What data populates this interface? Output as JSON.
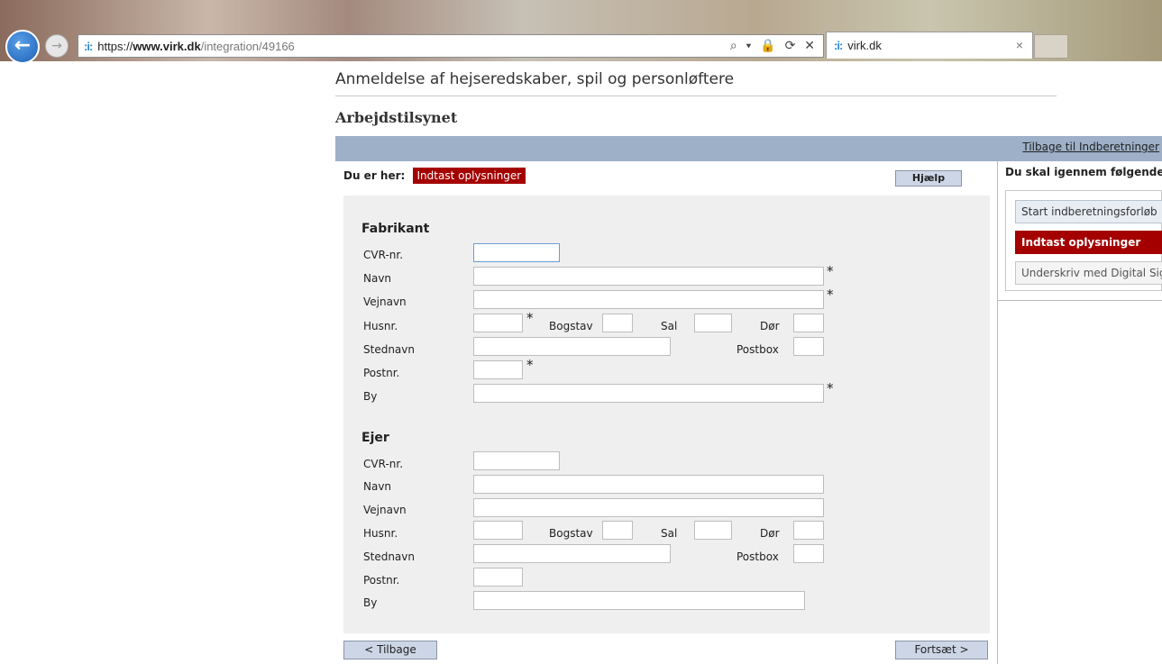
{
  "browser": {
    "url_scheme": "https://",
    "url_host": "www.virk.dk",
    "url_path": "/integration/49166",
    "address_actions": "⌕ ▾ 🔒 ⟳ ✕",
    "tab_title": "virk.dk",
    "tab_close": "×",
    "favicon": ":i:"
  },
  "page": {
    "title": "Anmeldelse af hejseredskaber, spil og personløftere",
    "organization": "Arbejdstilsynet",
    "back_link": "Tilbage til Indberetninger",
    "breadcrumb_label": "Du er her:",
    "breadcrumb_current": "Indtast oplysninger",
    "help_button": "Hjælp"
  },
  "form": {
    "required_mark": "*",
    "fabrikant": {
      "title": "Fabrikant",
      "cvr": "CVR-nr.",
      "navn": "Navn",
      "vejnavn": "Vejnavn",
      "husnr": "Husnr.",
      "bogstav": "Bogstav",
      "sal": "Sal",
      "dor": "Dør",
      "stednavn": "Stednavn",
      "postbox": "Postbox",
      "postnr": "Postnr.",
      "by": "By"
    },
    "ejer": {
      "title": "Ejer",
      "cvr": "CVR-nr.",
      "navn": "Navn",
      "vejnavn": "Vejnavn",
      "husnr": "Husnr.",
      "bogstav": "Bogstav",
      "sal": "Sal",
      "dor": "Dør",
      "stednavn": "Stednavn",
      "postbox": "Postbox",
      "postnr": "Postnr.",
      "by": "By"
    }
  },
  "buttons": {
    "back": "< Tilbage",
    "continue": "Fortsæt >"
  },
  "steps": {
    "heading": "Du skal igennem følgende",
    "items": [
      {
        "label": "Start indberetningsforløb"
      },
      {
        "label": "Indtast oplysninger"
      },
      {
        "label": "Underskriv med Digital Signatur"
      }
    ]
  }
}
